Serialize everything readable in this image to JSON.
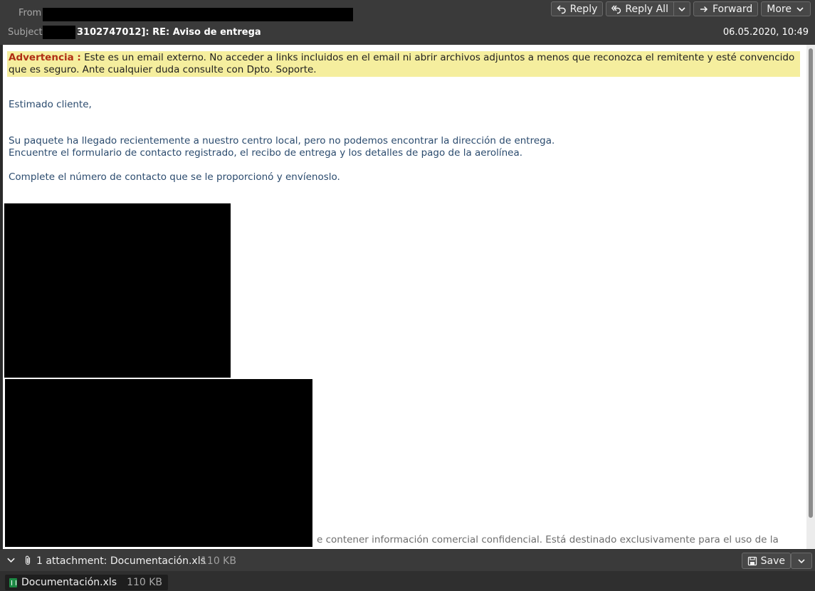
{
  "header": {
    "from_label": "From",
    "subject_label": "Subject",
    "subject": "3102747012]: RE: Aviso de entrega",
    "date": "06.05.2020, 10:49"
  },
  "toolbar": {
    "reply": "Reply",
    "reply_all": "Reply All",
    "forward": "Forward",
    "more": "More"
  },
  "body": {
    "warning_label": "Advertencia :",
    "warning_text": " Este es un email externo. No acceder a links incluidos en el email ni abrir archivos adjuntos a menos que reconozca el remitente y esté convencido que es seguro. Ante cualquier duda consulte con Dpto. Soporte.",
    "greeting": "Estimado cliente,",
    "line1": "Su paquete ha llegado recientemente a nuestro centro local, pero no podemos encontrar la dirección de entrega.",
    "line2": "Encuentre el formulario de contacto registrado, el recibo de entrega y los detalles de pago de la aerolínea.",
    "line3": "Complete el número de contacto que se le proporcionó y envíenoslo.",
    "disclaimer_fragment": "e contener información comercial confidencial. Está destinado exclusivamente para el uso de la"
  },
  "attachments": {
    "summary": "1 attachment: Documentación.xls",
    "size": "110 KB",
    "save_label": "Save",
    "file_name": "Documentación.xls",
    "file_size": "110 KB"
  },
  "icons": {
    "reply": "reply-icon",
    "reply_all": "reply-all-icon",
    "forward": "forward-icon",
    "dropdown": "chevron-down-icon",
    "attachment": "paperclip-icon",
    "save": "save-icon",
    "file": "spreadsheet-icon"
  },
  "colors": {
    "warning_bg": "#f5ee9e",
    "warning_label": "#b02e14",
    "body_text": "#2b4b6e",
    "header_bg": "#3a3a3a"
  }
}
